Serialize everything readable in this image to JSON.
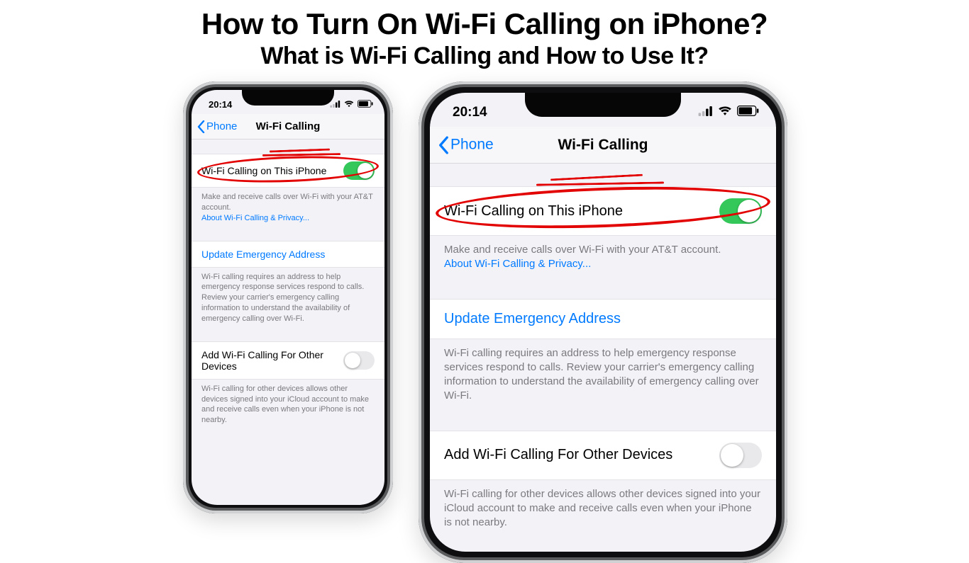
{
  "heading": {
    "title": "How to Turn On Wi-Fi Calling on iPhone?",
    "subtitle": "What is Wi-Fi Calling and How to Use It?"
  },
  "settings": {
    "status_time": "20:14",
    "back_label": "Phone",
    "screen_title": "Wi-Fi Calling",
    "row_wifi_calling": "Wi-Fi Calling on This iPhone",
    "wifi_calling_on": true,
    "footer1_text": "Make and receive calls over Wi-Fi with your AT&T account.",
    "footer1_link": "About Wi-Fi Calling & Privacy...",
    "row_update_emergency": "Update Emergency Address",
    "footer2": "Wi-Fi calling requires an address to help emergency response services respond to calls. Review your carrier's emergency calling information to understand the availability of emergency calling over Wi-Fi.",
    "row_other_devices": "Add Wi-Fi Calling For Other Devices",
    "other_devices_on": false,
    "footer3": "Wi-Fi calling for other devices allows other devices signed into your iCloud account to make and receive calls even when your iPhone is not nearby."
  },
  "annotation": {
    "circled_item": "Wi-Fi Calling on This iPhone toggle row",
    "color": "#e20000"
  }
}
